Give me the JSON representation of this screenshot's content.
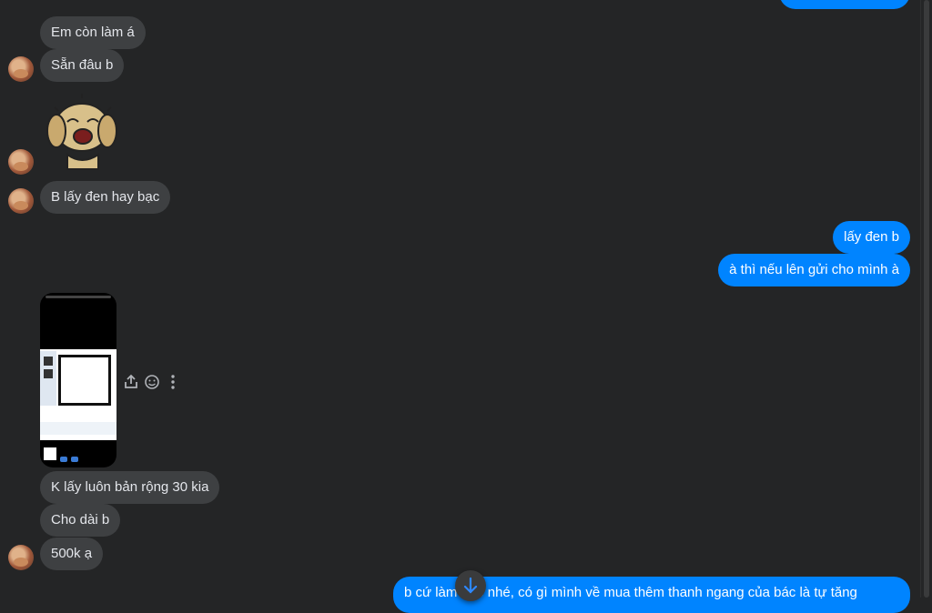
{
  "messages": {
    "incoming": [
      {
        "text": "Em còn làm á"
      },
      {
        "text": "Sẵn đâu b"
      },
      {
        "text": "B lấy đen hay bạc"
      },
      {
        "text": "K lấy luôn bản rộng 30 kia"
      },
      {
        "text": "Cho dài b"
      },
      {
        "text": "500k ạ"
      }
    ],
    "outgoing": [
      {
        "text": "lấy đen b"
      },
      {
        "text": "à thì nếu lên gửi cho mình à"
      },
      {
        "text": "b cứ làm nhỏ nhé, có gì mình về mua thêm thanh ngang của bác là tự tăng"
      }
    ]
  },
  "sticker": {
    "icon": "crying-dog-sticker"
  },
  "attachment": {
    "type": "screenshot-photo"
  },
  "actions": {
    "share": "share-icon",
    "react": "smiley-icon",
    "more": "more-icon"
  },
  "scroll_down": {
    "icon": "arrow-down-icon"
  },
  "colors": {
    "background": "#242526",
    "incoming": "#3e4042",
    "outgoing": "#0084ff"
  }
}
